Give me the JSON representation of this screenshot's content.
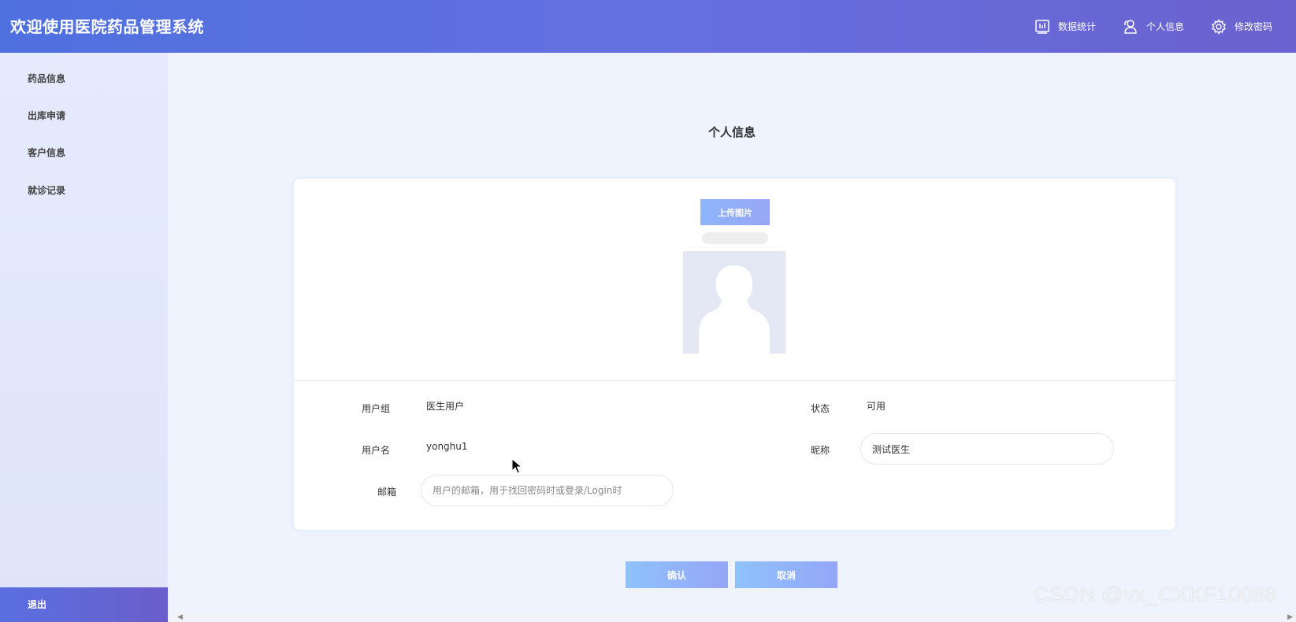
{
  "header": {
    "title": "欢迎使用医院药品管理系统",
    "nav": [
      {
        "label": "数据统计",
        "icon": "chart-icon"
      },
      {
        "label": "个人信息",
        "icon": "user-icon"
      },
      {
        "label": "修改密码",
        "icon": "gear-icon"
      }
    ]
  },
  "sidebar": {
    "items": [
      {
        "label": "药品信息"
      },
      {
        "label": "出库申请"
      },
      {
        "label": "客户信息"
      },
      {
        "label": "就诊记录"
      }
    ],
    "logout_label": "退出"
  },
  "page": {
    "title": "个人信息"
  },
  "profile": {
    "upload_label": "上传图片",
    "fields": {
      "group_label": "用户组",
      "group_value": "医生用户",
      "status_label": "状态",
      "status_value": "可用",
      "username_label": "用户名",
      "username_value": "yonghu1",
      "nickname_label": "昵称",
      "nickname_value": "测试医生",
      "email_label": "邮箱",
      "email_placeholder": "用户的邮箱，用于找回密码时或登录/Login时",
      "email_value": ""
    }
  },
  "actions": {
    "confirm_label": "确认",
    "cancel_label": "取消"
  },
  "watermark": "CSDN @vx_CXKF10088",
  "colors": {
    "header_start": "#4f70df",
    "header_end": "#6a62cf",
    "button_start": "#8fc2fb",
    "button_end": "#95a6f7",
    "page_bg": "#eef3fe"
  }
}
